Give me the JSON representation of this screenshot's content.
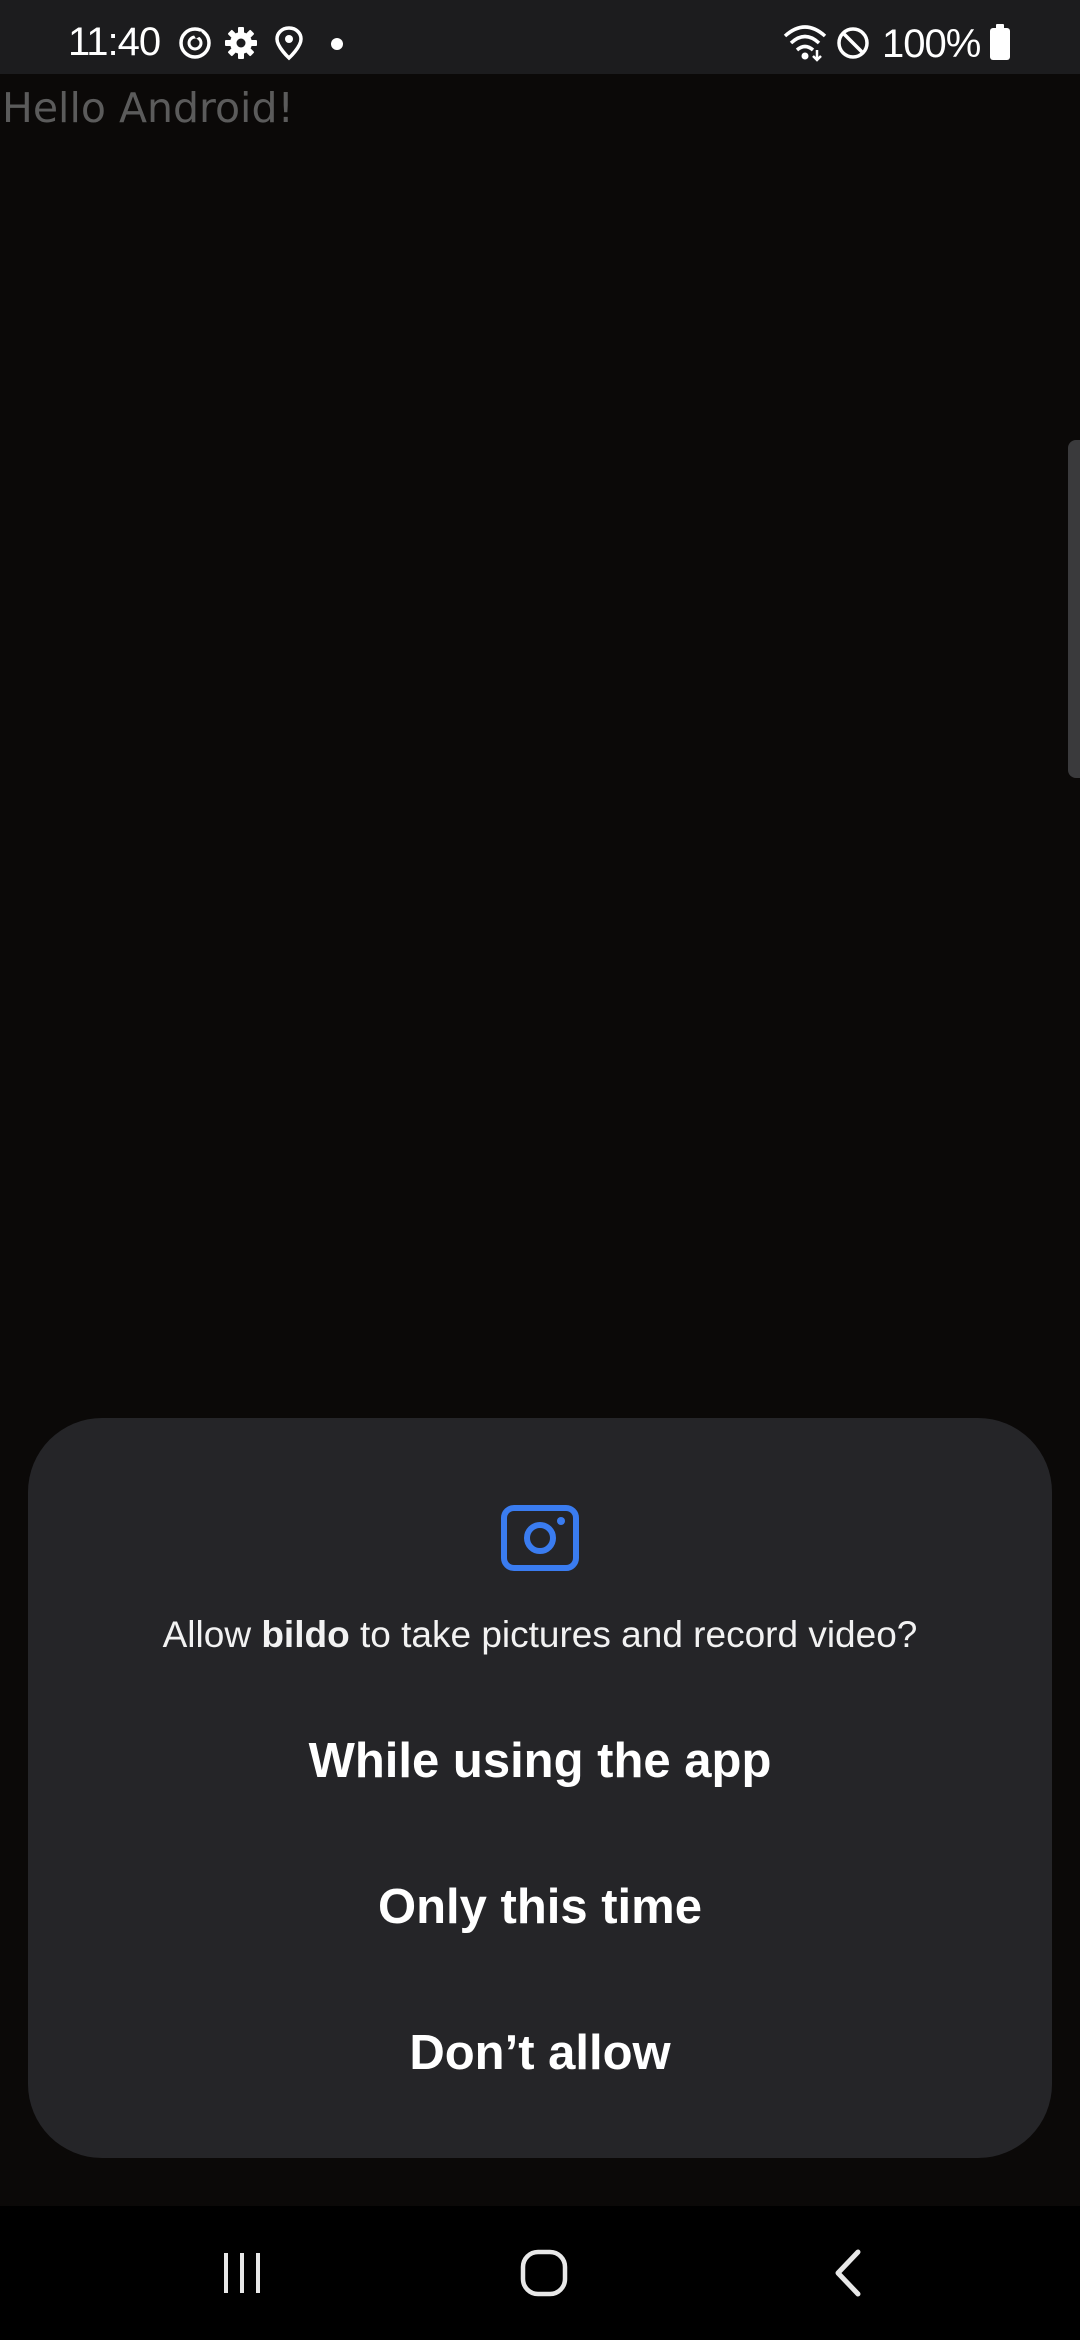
{
  "status_bar": {
    "time": "11:40",
    "battery": "100%",
    "icons": [
      "sync-icon",
      "settings-icon",
      "location-icon",
      "notification-dot-icon",
      "wifi-icon",
      "do-not-disturb-icon",
      "battery-icon"
    ]
  },
  "app": {
    "text": "Hello Android!"
  },
  "dialog": {
    "icon": "camera-icon",
    "message_prefix": "Allow ",
    "app_name": "bildo",
    "message_suffix": " to take pictures and record video?",
    "buttons": {
      "while_using": "While using the app",
      "only_this_time": "Only this time",
      "dont_allow": "Don’t allow"
    },
    "accent_color": "#3a7cf0"
  },
  "nav_bar": {
    "icons": [
      "recent-apps-icon",
      "home-icon",
      "back-icon"
    ]
  }
}
